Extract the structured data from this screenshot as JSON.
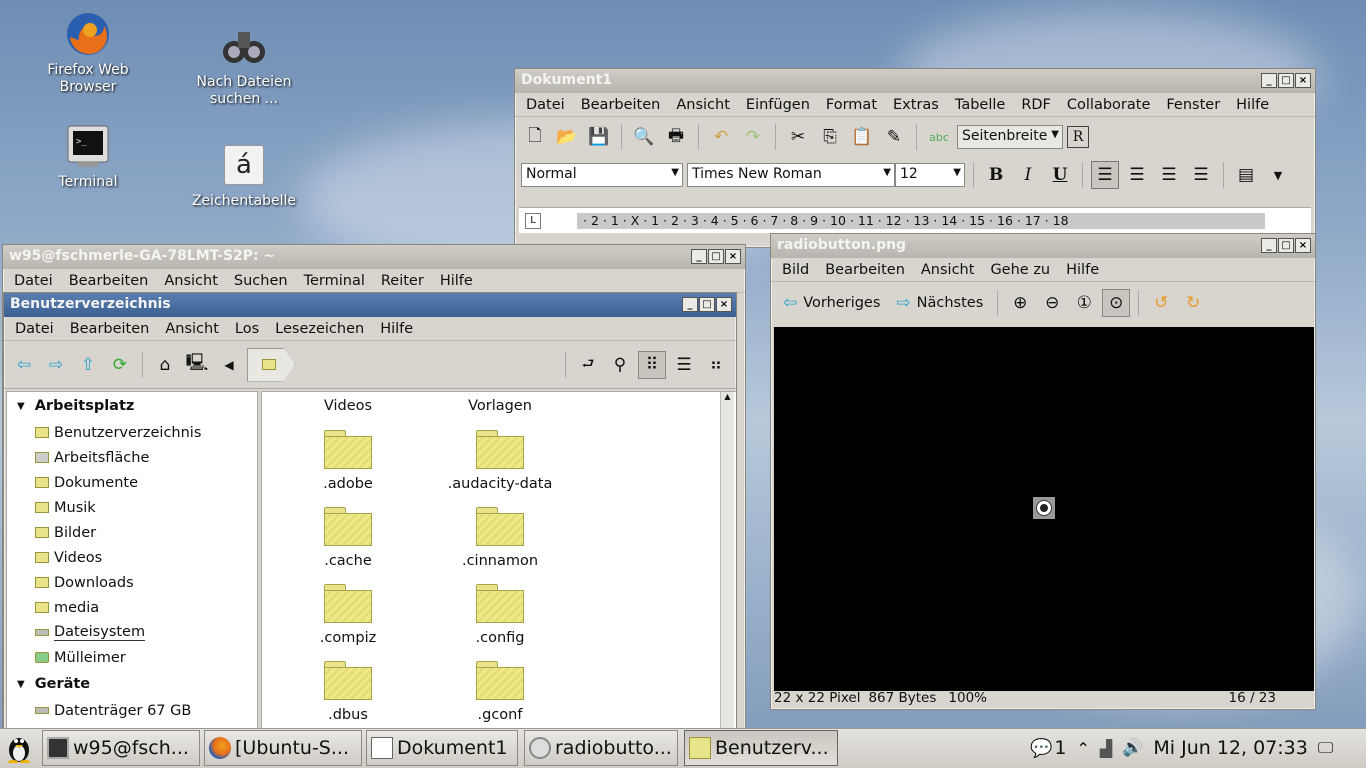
{
  "desktop": {
    "icons": [
      {
        "label": "Firefox Web Browser",
        "icon": "firefox-icon"
      },
      {
        "label": "Nach Dateien suchen ...",
        "icon": "binoculars-icon"
      },
      {
        "label": "Terminal",
        "icon": "terminal-icon"
      },
      {
        "label": "Zeichentabelle",
        "icon": "character-map-icon",
        "glyph": "á"
      }
    ]
  },
  "writer": {
    "title": "Dokument1",
    "menu": [
      "Datei",
      "Bearbeiten",
      "Ansicht",
      "Einfügen",
      "Format",
      "Extras",
      "Tabelle",
      "RDF",
      "Collaborate",
      "Fenster",
      "Hilfe"
    ],
    "zoom": "Seitenbreite",
    "style": "Normal",
    "font": "Times New Roman",
    "size": "12",
    "bold": "B",
    "italic": "I",
    "underline": "U",
    "ruler": "· 2 · 1 · X · 1 · 2 · 3 · 4 · 5 · 6 · 7 · 8 · 9 · 10 · 11 · 12 · 13 · 14 · 15 · 16 · 17 · 18"
  },
  "terminal": {
    "title": "w95@fschmerle-GA-78LMT-S2P: ~",
    "menu": [
      "Datei",
      "Bearbeiten",
      "Ansicht",
      "Suchen",
      "Terminal",
      "Reiter",
      "Hilfe"
    ]
  },
  "filemanager": {
    "title": "Benutzerverzeichnis",
    "menu": [
      "Datei",
      "Bearbeiten",
      "Ansicht",
      "Los",
      "Lesezeichen",
      "Hilfe"
    ],
    "sidebar": {
      "section1": "Arbeitsplatz",
      "items": [
        "Benutzerverzeichnis",
        "Arbeitsfläche",
        "Dokumente",
        "Musik",
        "Bilder",
        "Videos",
        "Downloads",
        "media",
        "Dateisystem",
        "Mülleimer"
      ],
      "section2": "Geräte",
      "devices": [
        "Datenträger 67 GB"
      ]
    },
    "files": [
      "Videos",
      "Vorlagen",
      ".adobe",
      ".audacity-data",
      ".cache",
      ".cinnamon",
      ".compiz",
      ".config",
      ".dbus",
      ".gconf"
    ]
  },
  "viewer": {
    "title": "radiobutton.png",
    "menu": [
      "Bild",
      "Bearbeiten",
      "Ansicht",
      "Gehe zu",
      "Hilfe"
    ],
    "prev": "Vorheriges",
    "next": "Nächstes",
    "status_size": "22 x 22 Pixel",
    "status_bytes": "867 Bytes",
    "status_zoom": "100%",
    "status_index": "16 / 23"
  },
  "taskbar": {
    "tasks": [
      "w95@fsch...",
      "[Ubuntu-S...",
      "Dokument1",
      "radiobutto...",
      "Benutzerv..."
    ],
    "notif_count": "1",
    "clock": "Mi Jun 12, 07:33"
  }
}
